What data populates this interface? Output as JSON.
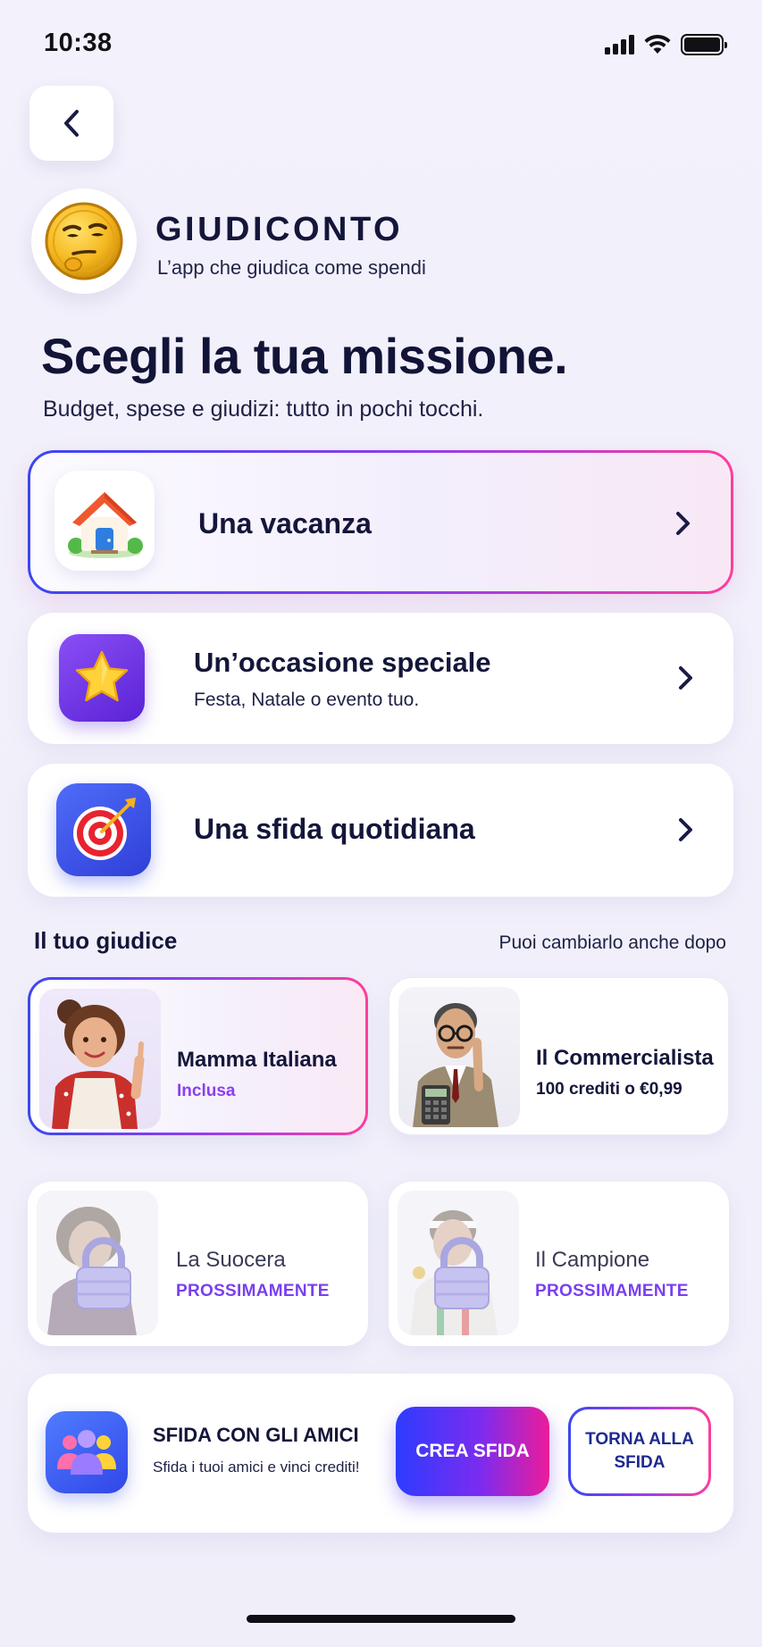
{
  "status_bar": {
    "time": "10:38"
  },
  "brand": {
    "name": "GIUDICONTO",
    "tagline": "L’app che giudica come spendi"
  },
  "header": {
    "title": "Scegli la tua missione.",
    "subtitle": "Budget, spese e giudizi: tutto in pochi tocchi."
  },
  "missions": [
    {
      "label": "Una vacanza",
      "icon": "house-icon",
      "selected": true
    },
    {
      "label": "Un’occasione speciale",
      "sub": "Festa, Natale o evento tuo.",
      "icon": "star-icon",
      "selected": false
    },
    {
      "label": "Una sfida quotidiana",
      "icon": "target-icon",
      "selected": false
    }
  ],
  "judges_section": {
    "title": "Il tuo giudice",
    "hint": "Puoi cambiarlo anche dopo"
  },
  "judges": [
    {
      "name": "Mamma Italiana",
      "price": "Inclusa",
      "selected": true,
      "locked": false
    },
    {
      "name": "Il Commercialista",
      "price": "100 crediti o €0,99",
      "selected": false,
      "locked": false
    },
    {
      "name": "La Suocera",
      "price": "PROSSIMAMENTE",
      "selected": false,
      "locked": true
    },
    {
      "name": "Il Campione",
      "price": "PROSSIMAMENTE",
      "selected": false,
      "locked": true
    }
  ],
  "friends": {
    "title": "SFIDA CON GLI AMICI",
    "subtitle": "Sfida i tuoi amici e vinci crediti!",
    "create_label": "CREA SFIDA",
    "return_label": "TORNA ALLA SFIDA"
  },
  "colors": {
    "accent_purple": "#7a3ff0",
    "accent_pink": "#ff3d9a",
    "accent_blue": "#3b47f0",
    "text_dark": "#14163a"
  }
}
